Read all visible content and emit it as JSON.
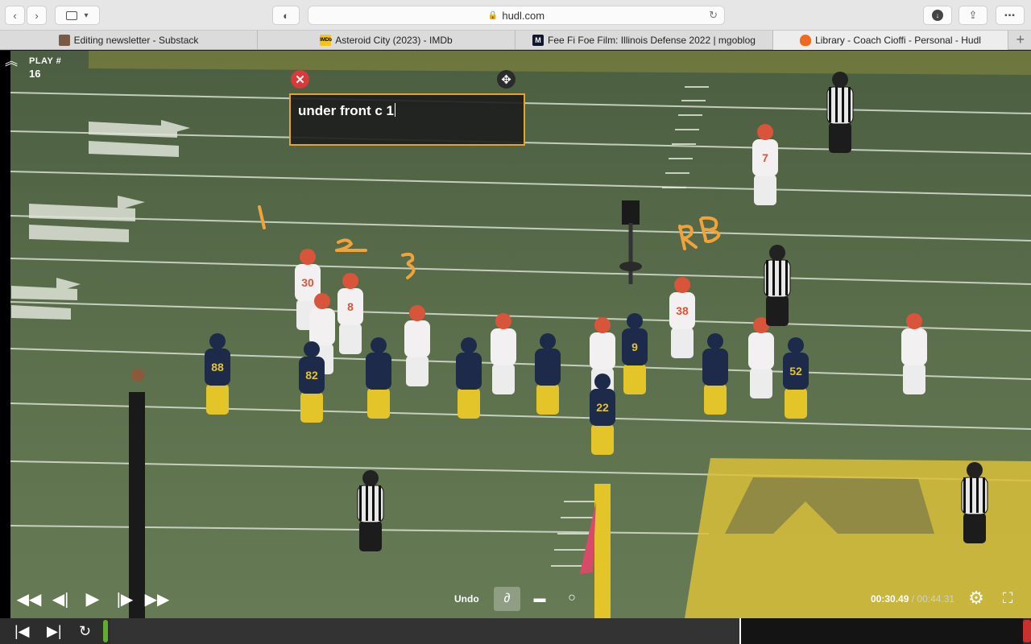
{
  "browser": {
    "url": "hudl.com",
    "tabs": [
      {
        "label": "Editing newsletter - Substack",
        "icon": "substack-icon"
      },
      {
        "label": "Asteroid City (2023) - IMDb",
        "icon": "imdb-icon"
      },
      {
        "label": "Fee Fi Foe Film: Illinois Defense 2022 | mgoblog",
        "icon": "mgoblog-icon"
      },
      {
        "label": "Library - Coach Cioffi - Personal - Hudl",
        "icon": "hudl-icon"
      }
    ]
  },
  "player": {
    "play_label": "PLAY #",
    "play_number": "16",
    "note_text": "under front c 1",
    "undo_label": "Undo",
    "current_time": "00:30.49",
    "time_separator": " / ",
    "total_time": "00:44.31"
  },
  "annotations": {
    "mark_1": "1",
    "mark_2": "2",
    "mark_3": "3",
    "mark_rb": "RB"
  },
  "jerseys": {
    "white": [
      "30",
      "8",
      "7",
      "38"
    ],
    "blue": [
      "88",
      "82",
      "9",
      "22",
      "52"
    ]
  },
  "colors": {
    "field_green": "#566b48",
    "maize": "#e3c52a",
    "navy": "#1e2a4a",
    "note_border": "#e0a52a",
    "close_red": "#d83a3a",
    "timeline_mark": "#5fae2f"
  }
}
